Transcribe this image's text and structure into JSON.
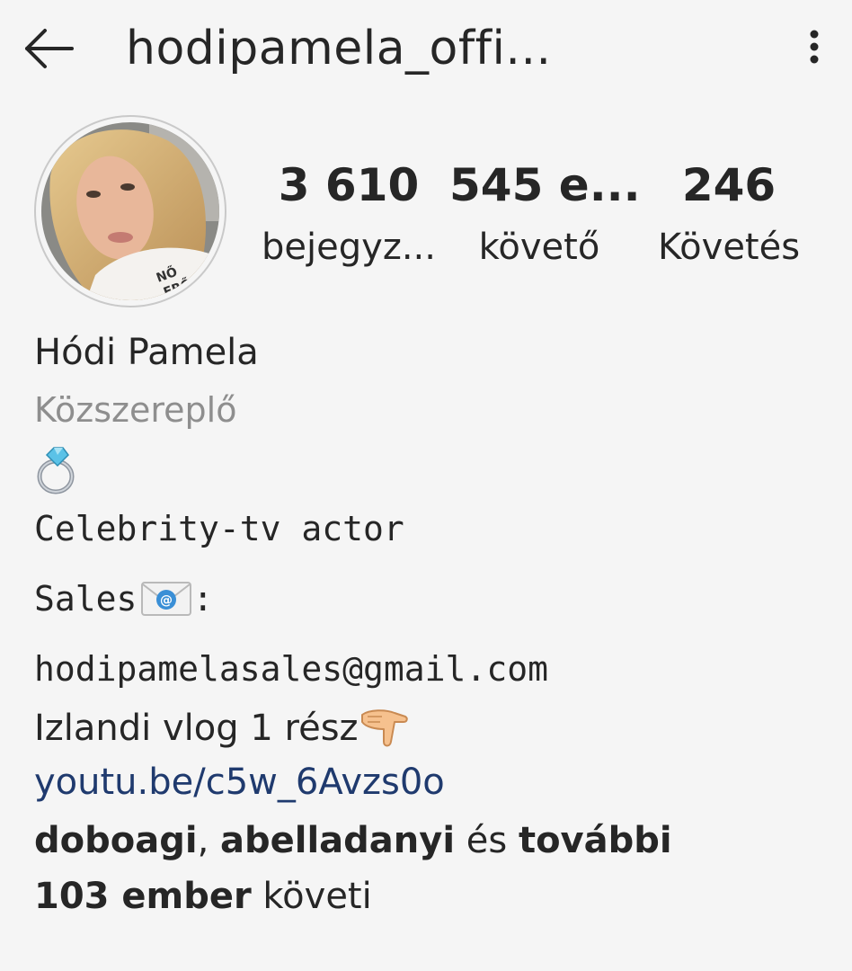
{
  "header": {
    "title": "hodipamela_offi...",
    "back_icon": "arrow-left-icon",
    "more_icon": "vertical-dots-icon"
  },
  "stats": {
    "posts_count": "3 610",
    "posts_label": "bejegyz...",
    "followers_count": "545 e...",
    "followers_label": "követő",
    "following_count": "246",
    "following_label": "Követés"
  },
  "profile": {
    "name": "Hódi Pamela",
    "category": "Közszereplő",
    "bio_ring_emoji": "ring-icon",
    "bio_line_actor": "Celebrity-tv actor",
    "bio_sales_label": "Sales",
    "bio_sales_colon": ":",
    "bio_email": "hodipamelasales@gmail.com",
    "bio_vlog": "Izlandi vlog 1 rész",
    "bio_vlog_icon": "pointing-down-hand-icon",
    "link": "youtu.be/c5w_6Avzs0o"
  },
  "followed_by": {
    "user1": "doboagi",
    "sep1": ", ",
    "user2": "abelladanyi",
    "middle": " és ",
    "more": "további",
    "count_text": "103 ember",
    "suffix": " követi"
  },
  "colors": {
    "background": "#f5f5f5",
    "text": "#262626",
    "secondary": "#8e8e8e",
    "link": "#1f3a6e"
  }
}
